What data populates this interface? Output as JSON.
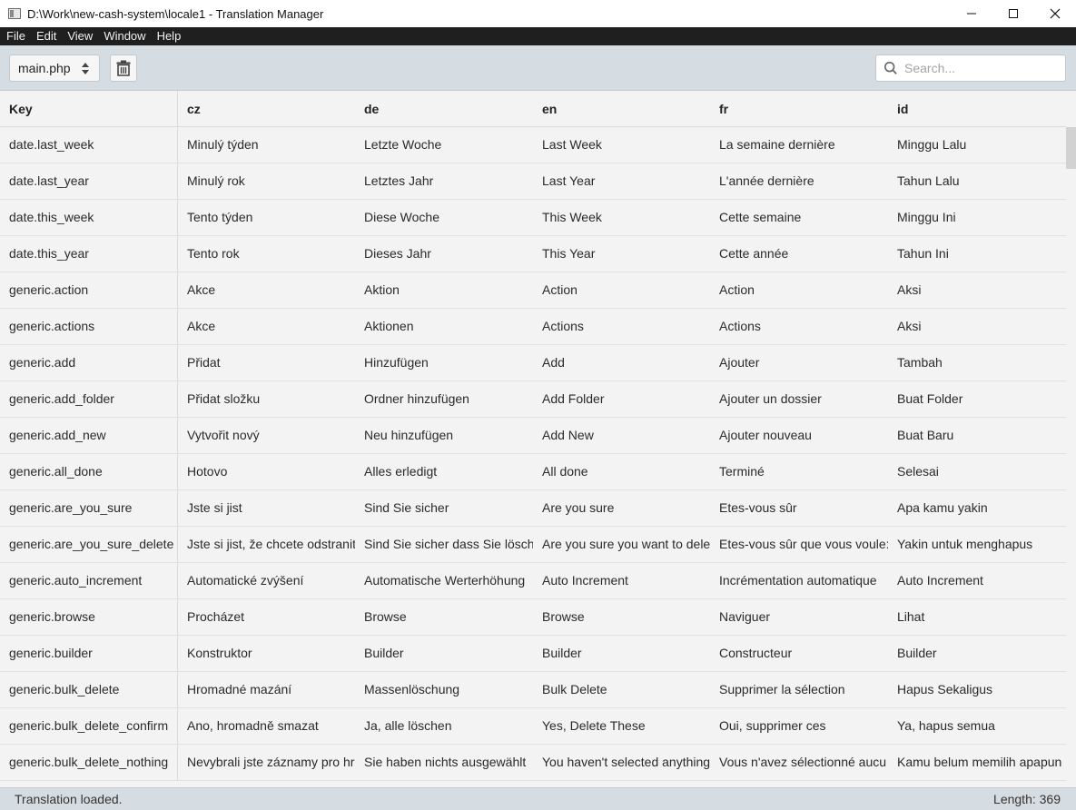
{
  "window": {
    "title": "D:\\Work\\new-cash-system\\locale1 - Translation Manager",
    "minimize": "—",
    "maximize": "☐",
    "close": "✕"
  },
  "menu": [
    "File",
    "Edit",
    "View",
    "Window",
    "Help"
  ],
  "toolbar": {
    "file_select_value": "main.php",
    "search_placeholder": "Search...",
    "search_value": ""
  },
  "table": {
    "columns": [
      "Key",
      "cz",
      "de",
      "en",
      "fr",
      "id"
    ],
    "rows": [
      [
        "date.last_week",
        "Minulý týden",
        "Letzte Woche",
        "Last Week",
        "La semaine dernière",
        "Minggu Lalu"
      ],
      [
        "date.last_year",
        "Minulý rok",
        "Letztes Jahr",
        "Last Year",
        "L'année dernière",
        "Tahun Lalu"
      ],
      [
        "date.this_week",
        "Tento týden",
        "Diese Woche",
        "This Week",
        "Cette semaine",
        "Minggu Ini"
      ],
      [
        "date.this_year",
        "Tento rok",
        "Dieses Jahr",
        "This Year",
        "Cette année",
        "Tahun Ini"
      ],
      [
        "generic.action",
        "Akce",
        "Aktion",
        "Action",
        "Action",
        "Aksi"
      ],
      [
        "generic.actions",
        "Akce",
        "Aktionen",
        "Actions",
        "Actions",
        "Aksi"
      ],
      [
        "generic.add",
        "Přidat",
        "Hinzufügen",
        "Add",
        "Ajouter",
        "Tambah"
      ],
      [
        "generic.add_folder",
        "Přidat složku",
        "Ordner hinzufügen",
        "Add Folder",
        "Ajouter un dossier",
        "Buat Folder"
      ],
      [
        "generic.add_new",
        "Vytvořit nový",
        "Neu hinzufügen",
        "Add New",
        "Ajouter nouveau",
        "Buat Baru"
      ],
      [
        "generic.all_done",
        "Hotovo",
        "Alles erledigt",
        "All done",
        "Terminé",
        "Selesai"
      ],
      [
        "generic.are_you_sure",
        "Jste si jist",
        "Sind Sie sicher",
        "Are you sure",
        "Etes-vous sûr",
        "Apa kamu yakin"
      ],
      [
        "generic.are_you_sure_delete",
        "Jste si jist, že chcete odstranit",
        "Sind Sie sicher dass Sie lösch",
        "Are you sure you want to dele",
        "Etes-vous sûr que vous voule:",
        "Yakin untuk menghapus"
      ],
      [
        "generic.auto_increment",
        "Automatické zvýšení",
        "Automatische Werterhöhung",
        "Auto Increment",
        "Incrémentation automatique",
        "Auto Increment"
      ],
      [
        "generic.browse",
        "Procházet",
        "Browse",
        "Browse",
        "Naviguer",
        "Lihat"
      ],
      [
        "generic.builder",
        "Konstruktor",
        "Builder",
        "Builder",
        "Constructeur",
        "Builder"
      ],
      [
        "generic.bulk_delete",
        "Hromadné mazání",
        "Massenlöschung",
        "Bulk Delete",
        "Supprimer la sélection",
        "Hapus Sekaligus"
      ],
      [
        "generic.bulk_delete_confirm",
        "Ano, hromadně smazat",
        "Ja, alle löschen",
        "Yes, Delete These",
        "Oui, supprimer ces",
        "Ya, hapus semua"
      ],
      [
        "generic.bulk_delete_nothing",
        "Nevybrali jste záznamy pro hr",
        "Sie haben nichts ausgewählt",
        "You haven't selected anything",
        "Vous n'avez sélectionné aucu",
        "Kamu belum memilih apapun"
      ]
    ]
  },
  "status": {
    "message": "Translation loaded.",
    "length": "Length: 369"
  },
  "icons": {
    "app": "window-icon",
    "select": "updown-arrows-icon",
    "delete": "trash-icon",
    "search": "search-icon"
  },
  "colors": {
    "menubar": "#1f1f1f",
    "toolbar": "#d6dde2",
    "table_bg": "#f3f3f3"
  }
}
